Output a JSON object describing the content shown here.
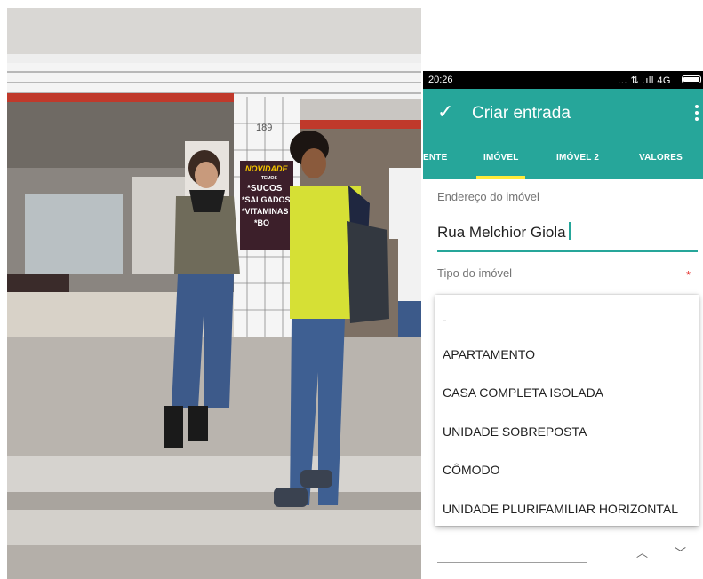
{
  "photo": {
    "sign": {
      "heading": "NOVIDADE",
      "sub": "TEMOS",
      "lines": [
        "*SUCOS",
        "*SALGADOS",
        "*VITAMINAS",
        "*BO"
      ]
    },
    "wall_number": "189"
  },
  "status_bar": {
    "time": "20:26",
    "network": "... ⇅ .ıll 4G"
  },
  "app_bar": {
    "title": "Criar entrada"
  },
  "tabs": [
    "ENTE",
    "IMÓVEL",
    "IMÓVEL 2",
    "VALORES"
  ],
  "active_tab": "IMÓVEL",
  "form": {
    "address_label": "Endereço do imóvel",
    "address_value": "Rua Melchior Giola",
    "type_label": "Tipo do imóvel",
    "required_mark": "*",
    "hidden_label": "imóvel"
  },
  "dropdown_options": [
    "-",
    "APARTAMENTO",
    "CASA COMPLETA ISOLADA",
    "UNIDADE SOBREPOSTA",
    "CÔMODO",
    "UNIDADE PLURIFAMILIAR HORIZONTAL"
  ],
  "colors": {
    "primary": "#26a69a",
    "tab_indicator": "#ffeb3b",
    "required": "#e53935"
  }
}
